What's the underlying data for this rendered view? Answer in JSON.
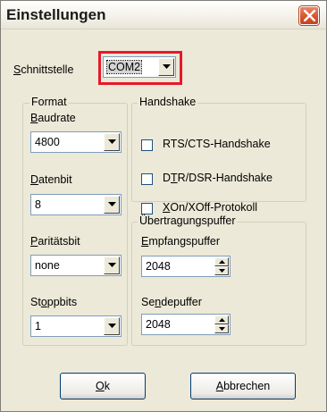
{
  "window": {
    "title": "Einstellungen"
  },
  "port": {
    "label": "Schnittstelle",
    "value": "COM2"
  },
  "format": {
    "title": "Format",
    "baudrate_label": "Baudrate",
    "baudrate_value": "4800",
    "datenbit_label": "Datenbit",
    "datenbit_value": "8",
    "paritaet_label": "Paritätsbit",
    "paritaet_value": "none",
    "stoppbits_label": "Stoppbits",
    "stoppbits_value": "1"
  },
  "handshake": {
    "title": "Handshake",
    "rts_label": "RTS/CTS-Handshake",
    "rts_checked": false,
    "dtr_label": "DTR/DSR-Handshake",
    "dtr_checked": false,
    "xon_label": "XOn/XOff-Protokoll",
    "xon_checked": false
  },
  "buffer": {
    "title": "Übertragungspuffer",
    "empfang_label": "Empfangspuffer",
    "empfang_value": "2048",
    "sende_label": "Sendepuffer",
    "sende_value": "2048"
  },
  "buttons": {
    "ok": "Ok",
    "cancel": "Abbrechen"
  },
  "colors": {
    "highlight": "#e8182a",
    "close_button": "#d65a36",
    "dialog_bg": "#ece9d8"
  }
}
